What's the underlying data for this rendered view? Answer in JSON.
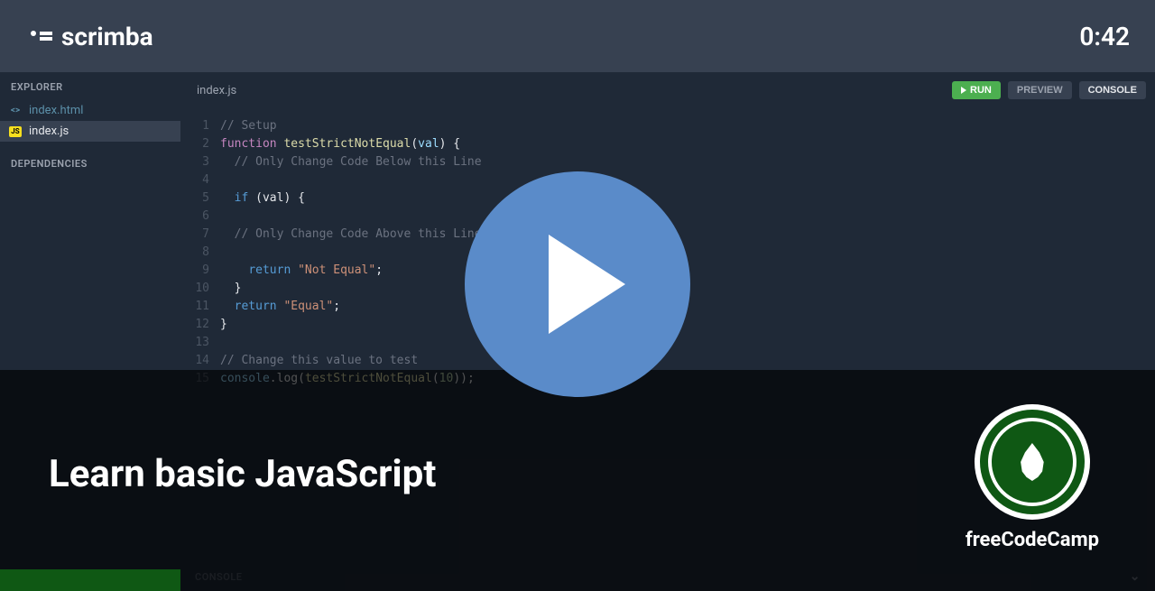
{
  "header": {
    "brand": "scrimba",
    "time": "0:42"
  },
  "sidebar": {
    "explorer_label": "EXPLORER",
    "dependencies_label": "DEPENDENCIES",
    "files": [
      {
        "name": "index.html",
        "icon": "<>",
        "type": "html",
        "active": false
      },
      {
        "name": "index.js",
        "icon": "JS",
        "type": "js",
        "active": true
      }
    ]
  },
  "editor": {
    "filename": "index.js",
    "buttons": {
      "run": "RUN",
      "preview": "PREVIEW",
      "console": "CONSOLE"
    },
    "console_label": "CONSOLE",
    "code": {
      "tokens": [
        [
          {
            "c": "comment",
            "t": "// Setup"
          }
        ],
        [
          {
            "c": "keyword",
            "t": "function"
          },
          {
            "c": "plain",
            "t": " "
          },
          {
            "c": "fn-name",
            "t": "testStrictNotEqual"
          },
          {
            "c": "plain",
            "t": "("
          },
          {
            "c": "var-name",
            "t": "val"
          },
          {
            "c": "plain",
            "t": ") {"
          }
        ],
        [
          {
            "c": "plain",
            "t": "  "
          },
          {
            "c": "comment",
            "t": "// Only Change Code Below this Line"
          }
        ],
        [],
        [
          {
            "c": "plain",
            "t": "  "
          },
          {
            "c": "keyword2",
            "t": "if"
          },
          {
            "c": "plain",
            "t": " (val) {"
          }
        ],
        [],
        [
          {
            "c": "plain",
            "t": "  "
          },
          {
            "c": "comment",
            "t": "// Only Change Code Above this Line"
          }
        ],
        [],
        [
          {
            "c": "plain",
            "t": "    "
          },
          {
            "c": "keyword2",
            "t": "return"
          },
          {
            "c": "plain",
            "t": " "
          },
          {
            "c": "string",
            "t": "\"Not Equal\""
          },
          {
            "c": "plain",
            "t": ";"
          }
        ],
        [
          {
            "c": "plain",
            "t": "  }"
          }
        ],
        [
          {
            "c": "plain",
            "t": "  "
          },
          {
            "c": "keyword2",
            "t": "return"
          },
          {
            "c": "plain",
            "t": " "
          },
          {
            "c": "string",
            "t": "\"Equal\""
          },
          {
            "c": "plain",
            "t": ";"
          }
        ],
        [
          {
            "c": "plain",
            "t": "}"
          }
        ],
        [],
        [
          {
            "c": "comment",
            "t": "// Change this value to test"
          }
        ],
        [
          {
            "c": "var-name",
            "t": "console"
          },
          {
            "c": "plain",
            "t": ".log("
          },
          {
            "c": "fn-name",
            "t": "testStrictNotEqual"
          },
          {
            "c": "plain",
            "t": "("
          },
          {
            "c": "number",
            "t": "10"
          },
          {
            "c": "plain",
            "t": "));"
          }
        ]
      ]
    }
  },
  "overlay": {
    "title": "Learn basic JavaScript",
    "instructor": "freeCodeCamp"
  }
}
